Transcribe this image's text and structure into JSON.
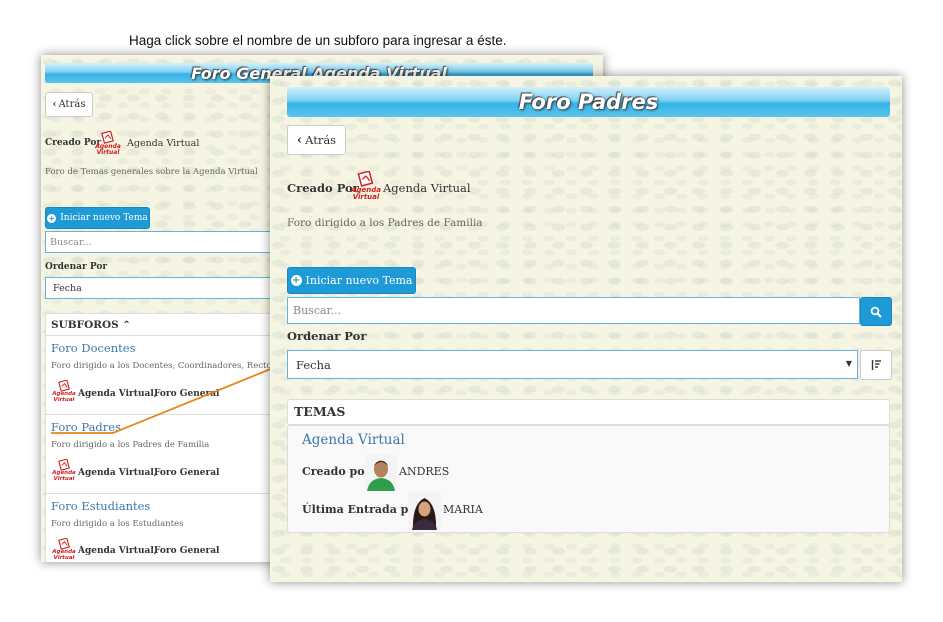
{
  "instruction": "Haga click sobre el nombre de un subforo para ingresar a éste.",
  "back_panel": {
    "banner_title": "Foro General Agenda Virtual",
    "back_label": "Atrás",
    "created_by_label": "Creado Por",
    "logo_text_1": "Agenda",
    "logo_text_2": "Virtual",
    "creator_name": "Agenda Virtual",
    "description": "Foro de Temas generales sobre la Agenda Virtual",
    "new_topic_label": "Iniciar nuevo Tema",
    "search_placeholder": "Buscar...",
    "order_label": "Ordenar Por",
    "order_value": "Fecha",
    "subforos_label": "SUBFOROS",
    "subforos": [
      {
        "title": "Foro Docentes",
        "description": "Foro dirigido a los Docentes, Coordinadores, Rectores",
        "author": "Agenda Virtual,",
        "parent": "Foro General"
      },
      {
        "title": "Foro Padres",
        "description": "Foro dirigido a los Padres de Familia",
        "author": "Agenda Virtual,",
        "parent": "Foro General"
      },
      {
        "title": "Foro Estudiantes",
        "description": "Foro dirigido a los Estudiantes",
        "author": "Agenda Virtual,",
        "parent": "Foro General"
      }
    ]
  },
  "front_panel": {
    "banner_title": "Foro Padres",
    "back_label": "Atrás",
    "created_by_label": "Creado Por",
    "logo_text_1": "Agenda",
    "logo_text_2": "Virtual",
    "creator_name": "Agenda Virtual",
    "description": "Foro dirigido a los Padres de Familia",
    "new_topic_label": "Iniciar nuevo Tema",
    "search_placeholder": "Buscar...",
    "order_label": "Ordenar Por",
    "order_value": "Fecha",
    "temas_label": "TEMAS",
    "topic": {
      "title": "Agenda Virtual",
      "created_by_label": "Creado por",
      "created_by_name": "ANDRES",
      "last_entry_label": "Última Entrada por",
      "last_entry_name": "MARIA"
    }
  },
  "colors": {
    "primary": "#1e9ad6",
    "arrow": "#e8841a",
    "link": "#3a78ad",
    "panel_bg": "#f6f4e2"
  }
}
